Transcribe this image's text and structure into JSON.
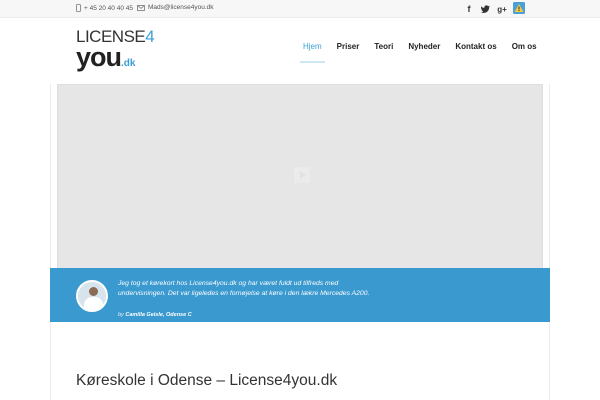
{
  "topbar": {
    "phone": "+ 45 20 40 40 45",
    "email": "Mads@license4you.dk",
    "social": [
      {
        "icon": "facebook-icon",
        "glyph": "f"
      },
      {
        "icon": "twitter-icon",
        "glyph": "t"
      },
      {
        "icon": "google-plus-icon",
        "glyph": "g+"
      },
      {
        "icon": "warning-icon",
        "glyph": "!"
      }
    ]
  },
  "logo": {
    "line1": "LICENSE",
    "line1_accent": "4",
    "line2": "you",
    "line2_suffix": ".dk"
  },
  "nav": {
    "items": [
      "Hjem",
      "Priser",
      "Teori",
      "Nyheder",
      "Kontakt os",
      "Om os"
    ],
    "active_index": 0
  },
  "slider": {
    "play_icon": "play-icon"
  },
  "testimonial": {
    "quote": "Jeg tog et kørekort hos License4you.dk og har været fuldt ud tilfreds med undervisningen. Det var ligeledes en fornøjelse at køre i den lækre Mercedes A200.",
    "author_prefix": "by",
    "author": "Camilla Geisle, Odense C"
  },
  "content": {
    "title": "Køreskole i Odense – License4you.dk"
  },
  "colors": {
    "accent": "#3a99cf",
    "text": "#333333",
    "topbar_bg": "#f7f7f7"
  }
}
